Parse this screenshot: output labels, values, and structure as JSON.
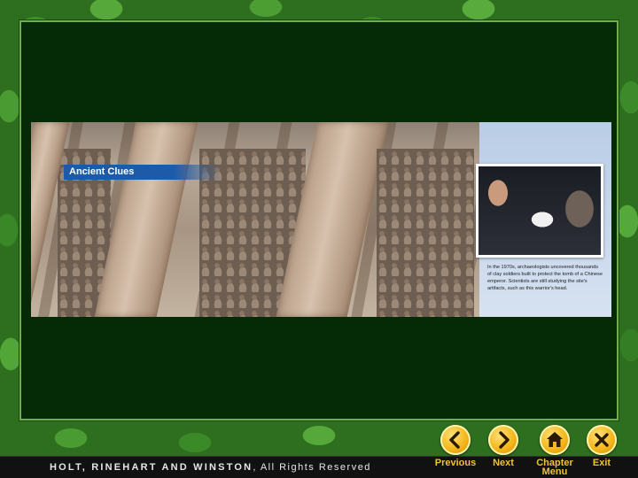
{
  "photo": {
    "caption_banner": "Ancient Clues",
    "inset_caption": "In the 1970s, archaeologists uncovered thousands of clay soldiers built to protect the tomb of a Chinese emperor. Scientists are still studying the site's artifacts, such as this warrior's head."
  },
  "footer": {
    "publisher": "HOLT, RINEHART AND WINSTON",
    "rights": ", All Rights Reserved"
  },
  "nav": {
    "previous": "Previous",
    "next": "Next",
    "chapter_menu_line1": "Chapter",
    "chapter_menu_line2": "Menu",
    "exit": "Exit"
  },
  "colors": {
    "panel_bg": "#042b06",
    "banner_blue": "#1d5ba8",
    "nav_gold": "#f3b415",
    "nav_label": "#f2c231"
  },
  "icons": {
    "previous": "chevron-left-icon",
    "next": "chevron-right-icon",
    "chapter_menu": "home-icon",
    "exit": "close-icon"
  }
}
